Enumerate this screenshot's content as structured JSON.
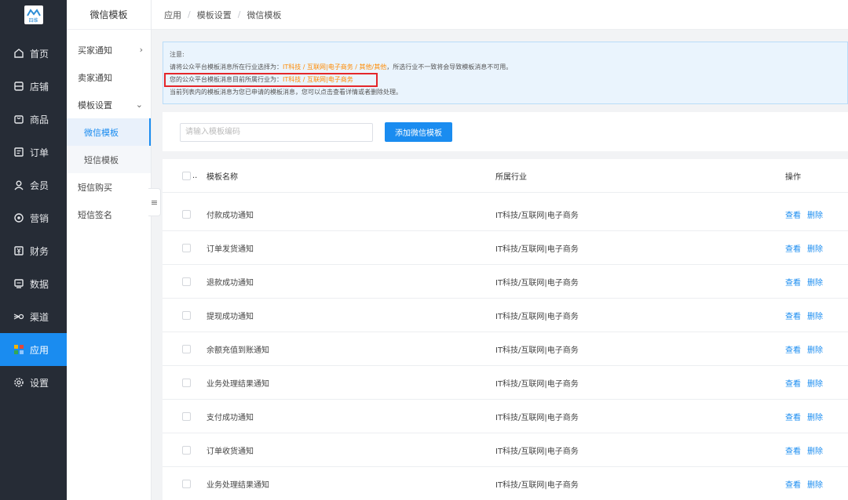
{
  "logo": {
    "text": "四维"
  },
  "nav": [
    {
      "label": "首页",
      "icon": "home-icon"
    },
    {
      "label": "店铺",
      "icon": "shop-icon"
    },
    {
      "label": "商品",
      "icon": "goods-icon"
    },
    {
      "label": "订单",
      "icon": "order-icon"
    },
    {
      "label": "会员",
      "icon": "member-icon"
    },
    {
      "label": "营销",
      "icon": "marketing-icon"
    },
    {
      "label": "财务",
      "icon": "finance-icon"
    },
    {
      "label": "数据",
      "icon": "data-icon"
    },
    {
      "label": "渠道",
      "icon": "channel-icon"
    },
    {
      "label": "应用",
      "icon": "apps-icon",
      "active": true
    },
    {
      "label": "设置",
      "icon": "settings-icon"
    }
  ],
  "submenu": {
    "title": "微信模板",
    "items": [
      {
        "label": "买家通知"
      },
      {
        "label": "卖家通知"
      },
      {
        "label": "模板设置"
      },
      {
        "label": "微信模板"
      },
      {
        "label": "短信模板"
      },
      {
        "label": "短信购买"
      },
      {
        "label": "短信签名"
      }
    ],
    "collapse_glyph": "≡"
  },
  "breadcrumb": [
    "应用",
    "模板设置",
    "微信模板"
  ],
  "breadcrumb_sep": "/",
  "notice": {
    "title": "注意:",
    "line1_pre": "请将公众平台模板消息所在行业选择为：",
    "line1_hl": "IT科技 / 互联网|电子商务 / 其他/其他",
    "line1_post": "，所选行业不一致将会导致模板消息不可用。",
    "line2_pre": "您的公众平台模板消息目前所属行业为：",
    "line2_hl": "IT科技 / 互联网|电子商务",
    "line3": "当前列表内的模板消息为您已申请的模板消息，您可以点击查看详情或者删除处理。"
  },
  "toolbar": {
    "search_placeholder": "请输入模板编码",
    "add_button": "添加微信模板"
  },
  "table": {
    "head_dots": "..",
    "columns": {
      "name": "模板名称",
      "industry": "所属行业",
      "ops": "操作"
    },
    "view_label": "查看",
    "delete_label": "删除",
    "rows": [
      {
        "name": "付款成功通知",
        "industry": "IT科技/互联网|电子商务"
      },
      {
        "name": "订单发货通知",
        "industry": "IT科技/互联网|电子商务"
      },
      {
        "name": "退款成功通知",
        "industry": "IT科技/互联网|电子商务"
      },
      {
        "name": "提现成功通知",
        "industry": "IT科技/互联网|电子商务"
      },
      {
        "name": "余额充值到账通知",
        "industry": "IT科技/互联网|电子商务"
      },
      {
        "name": "业务处理结果通知",
        "industry": "IT科技/互联网|电子商务"
      },
      {
        "name": "支付成功通知",
        "industry": "IT科技/互联网|电子商务"
      },
      {
        "name": "订单收货通知",
        "industry": "IT科技/互联网|电子商务"
      },
      {
        "name": "业务处理结果通知",
        "industry": "IT科技/互联网|电子商务"
      }
    ]
  },
  "colors": {
    "accent": "#1a8cf0",
    "nav_bg": "#262c36",
    "highlight": "#ff8a00",
    "alert_border": "#e4262a"
  }
}
